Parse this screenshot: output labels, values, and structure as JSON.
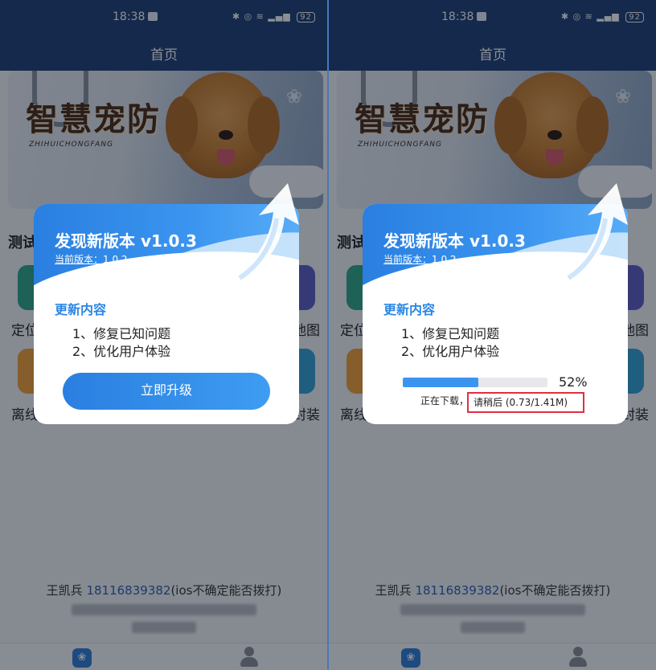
{
  "status_bar": {
    "time": "18:38",
    "battery": "92"
  },
  "nav": {
    "title": "首页"
  },
  "banner": {
    "title": "智慧宠防",
    "subtitle": "ZHIHUICHONGFANG"
  },
  "section": {
    "title": "测试"
  },
  "tiles": [
    {
      "label": "定位",
      "color": "#2fa88a"
    },
    {
      "label": "地图",
      "color": "#5b5fc7"
    },
    {
      "label": "离线",
      "color": "#f2a33a"
    },
    {
      "label": "封装",
      "color": "#34a3d6"
    }
  ],
  "footer": {
    "contact_name": "王凯兵",
    "phone": "18116839382",
    "note": "(ios不确定能否拨打)"
  },
  "tabbar": {
    "home_icon": "paw-icon",
    "user_icon": "user-icon"
  },
  "dialog": {
    "title": "发现新版本 v1.0.3",
    "current_version": "当前版本：1.0.2",
    "content_heading": "更新内容",
    "items": [
      "1、修复已知问题",
      "2、优化用户体验"
    ],
    "upgrade_button": "立即升级"
  },
  "download": {
    "progress_percent": 52,
    "percent_label": "52%",
    "status_label": "正在下载，",
    "wait_label": "请稍后 (0.73/1.41M)"
  },
  "colors": {
    "primary": "#2a7fe0",
    "nav": "#1d3f73",
    "highlight_box": "#e03040"
  }
}
